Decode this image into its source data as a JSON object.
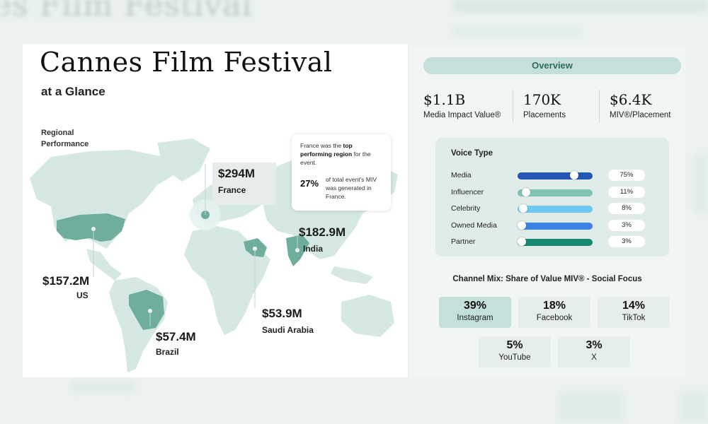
{
  "page": {
    "title": "Cannes Film Festival",
    "subtitle": "at a Glance",
    "section_label": "Regional Performance"
  },
  "callout": {
    "text_pre": "France was the ",
    "text_bold": "top performing region",
    "text_post": " for the event.",
    "pct": "27%",
    "pct_desc": "of total event's MIV was generated in France."
  },
  "regions": [
    {
      "value": "$294M",
      "name": "France"
    },
    {
      "value": "$182.9M",
      "name": "India"
    },
    {
      "value": "$157.2M",
      "name": "US"
    },
    {
      "value": "$53.9M",
      "name": "Saudi Arabia"
    },
    {
      "value": "$57.4M",
      "name": "Brazil"
    }
  ],
  "overview": {
    "header": "Overview",
    "stats": [
      {
        "value": "$1.1B",
        "label": "Media Impact Value®"
      },
      {
        "value": "170K",
        "label": "Placements"
      },
      {
        "value": "$6.4K",
        "label": "MIV®/Placement"
      }
    ]
  },
  "voice_type": {
    "title": "Voice Type",
    "rows": [
      {
        "label": "Media",
        "pct": "75%",
        "fraction": 0.75,
        "color": "#2457b5"
      },
      {
        "label": "Influencer",
        "pct": "11%",
        "fraction": 0.11,
        "color": "#7fc4b4"
      },
      {
        "label": "Celebrity",
        "pct": "8%",
        "fraction": 0.08,
        "color": "#6cc8f0"
      },
      {
        "label": "Owned Media",
        "pct": "3%",
        "fraction": 0.03,
        "color": "#3b82e6"
      },
      {
        "label": "Partner",
        "pct": "3%",
        "fraction": 0.03,
        "color": "#17876f"
      }
    ]
  },
  "channel_mix": {
    "title": "Channel Mix: Share of Value MIV® - Social Focus",
    "channels": [
      {
        "pct": "39%",
        "name": "Instagram"
      },
      {
        "pct": "18%",
        "name": "Facebook"
      },
      {
        "pct": "14%",
        "name": "TikTok"
      },
      {
        "pct": "5%",
        "name": "YouTube"
      },
      {
        "pct": "3%",
        "name": "X"
      }
    ]
  },
  "background": {
    "title_fragment": "es Film Festival"
  },
  "colors": {
    "map_land": "#cfe4de",
    "map_highlight": "#6fae9c",
    "accent_teal": "#2e6a60"
  }
}
